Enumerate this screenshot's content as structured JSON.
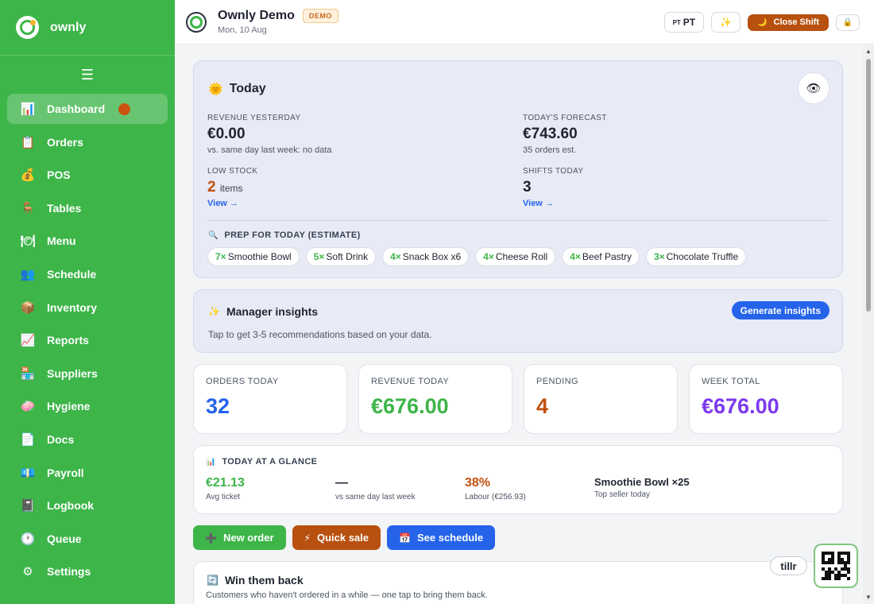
{
  "brand": {
    "name": "ownly",
    "menu_icon": "☰"
  },
  "sidebar": {
    "items": [
      {
        "label": "Dashboard",
        "icon": "📊"
      },
      {
        "label": "Orders",
        "icon": "📋"
      },
      {
        "label": "POS",
        "icon": "💰"
      },
      {
        "label": "Tables",
        "icon": "🪑"
      },
      {
        "label": "Menu",
        "icon": "🍽"
      },
      {
        "label": "Schedule",
        "icon": "👥"
      },
      {
        "label": "Inventory",
        "icon": "📦"
      },
      {
        "label": "Reports",
        "icon": "📈"
      },
      {
        "label": "Suppliers",
        "icon": "🏪"
      },
      {
        "label": "Hygiene",
        "icon": "🧼"
      },
      {
        "label": "Docs",
        "icon": "📄"
      },
      {
        "label": "Payroll",
        "icon": "💶"
      },
      {
        "label": "Logbook",
        "icon": "📓"
      },
      {
        "label": "Queue",
        "icon": "🕐"
      },
      {
        "label": "Settings",
        "icon": "⚙"
      }
    ]
  },
  "header": {
    "title": "Ownly Demo",
    "badge": "DEMO",
    "date": "Mon, 10 Aug",
    "lang_flag": "PT",
    "lang_label": "PT",
    "sparkle": "✨",
    "close_shift": "Close Shift",
    "moon": "🌙",
    "lock": "🔒"
  },
  "today": {
    "title": "Today",
    "sun": "🌞",
    "eye": "👁",
    "revenue_yesterday": {
      "label": "REVENUE YESTERDAY",
      "value": "€0.00",
      "sub": "vs. same day last week: no data"
    },
    "forecast": {
      "label": "TODAY'S FORECAST",
      "value": "€743.60",
      "sub": "35 orders est."
    },
    "low_stock": {
      "label": "LOW STOCK",
      "value": "2",
      "unit": "items",
      "link": "View →"
    },
    "shifts": {
      "label": "SHIFTS TODAY",
      "value": "3",
      "link": "View →"
    },
    "prep_title": "PREP FOR TODAY (ESTIMATE)",
    "prep_icon": "🔍",
    "prep": [
      {
        "qty": "7×",
        "name": "Smoothie Bowl"
      },
      {
        "qty": "5×",
        "name": "Soft Drink"
      },
      {
        "qty": "4×",
        "name": "Snack Box x6"
      },
      {
        "qty": "4×",
        "name": "Cheese Roll"
      },
      {
        "qty": "4×",
        "name": "Beef Pastry"
      },
      {
        "qty": "3×",
        "name": "Chocolate Truffle"
      }
    ]
  },
  "insights": {
    "icon": "✨",
    "title": "Manager insights",
    "subtitle": "Tap to get 3-5 recommendations based on your data.",
    "button": "Generate insights"
  },
  "metrics": [
    {
      "label": "ORDERS TODAY",
      "value": "32",
      "color": "#2563eb"
    },
    {
      "label": "REVENUE TODAY",
      "value": "€676.00",
      "color": "#3db549"
    },
    {
      "label": "PENDING",
      "value": "4",
      "color": "#c2500e"
    },
    {
      "label": "WEEK TOTAL",
      "value": "€676.00",
      "color": "#7c3aed"
    }
  ],
  "glance": {
    "icon": "📊",
    "title": "TODAY AT A GLANCE",
    "avg_ticket": {
      "value": "€21.13",
      "sub": "Avg ticket"
    },
    "vs_last_week": {
      "value": "—",
      "sub": "vs same day last week"
    },
    "labour": {
      "value": "38%",
      "sub": "Labour (€256.93)"
    },
    "top_seller": {
      "value": "Smoothie Bowl ×25",
      "sub": "Top seller today"
    }
  },
  "actions": [
    {
      "label": "New order",
      "icon": "➕",
      "color": "#3db549"
    },
    {
      "label": "Quick sale",
      "icon": "⚡",
      "color": "#b8500f"
    },
    {
      "label": "See schedule",
      "icon": "📅",
      "color": "#2563eb"
    }
  ],
  "winback": {
    "icon": "🔄",
    "title": "Win them back",
    "subtitle": "Customers who haven't ordered in a while — one tap to bring them back."
  },
  "widget": {
    "tillr": "tillr"
  }
}
